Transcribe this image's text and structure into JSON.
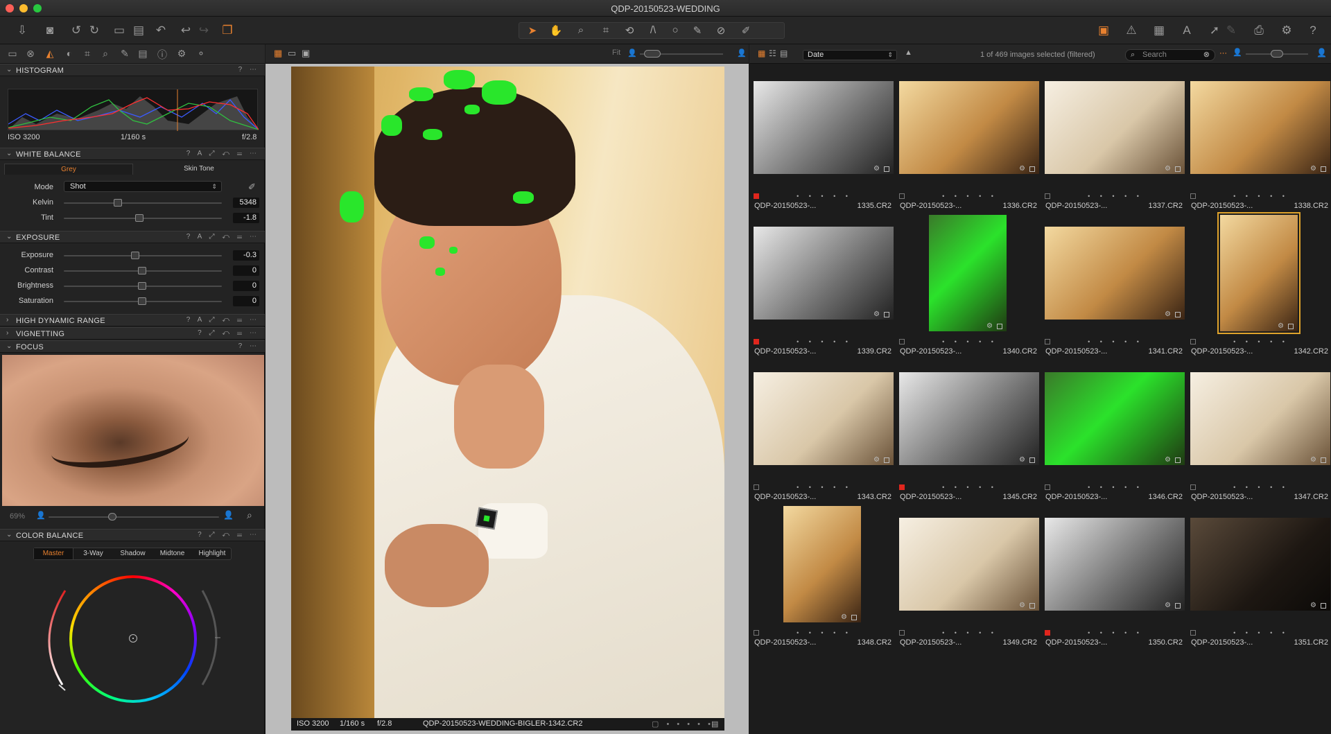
{
  "window": {
    "title": "QDP-20150523-WEDDING"
  },
  "histogram": {
    "title": "HISTOGRAM",
    "iso": "ISO 3200",
    "shutter": "1/160 s",
    "aperture": "f/2.8"
  },
  "white_balance": {
    "title": "WHITE BALANCE",
    "tabs": [
      "Grey",
      "Skin Tone"
    ],
    "mode_label": "Mode",
    "mode_value": "Shot",
    "kelvin_label": "Kelvin",
    "kelvin_value": "5348",
    "tint_label": "Tint",
    "tint_value": "-1.8"
  },
  "exposure": {
    "title": "EXPOSURE",
    "rows": [
      {
        "label": "Exposure",
        "value": "-0.3"
      },
      {
        "label": "Contrast",
        "value": "0"
      },
      {
        "label": "Brightness",
        "value": "0"
      },
      {
        "label": "Saturation",
        "value": "0"
      }
    ]
  },
  "sections": {
    "hdr": "HIGH DYNAMIC RANGE",
    "vignetting": "VIGNETTING",
    "focus": "FOCUS",
    "color_balance": "COLOR BALANCE"
  },
  "focus": {
    "zoom": "69%"
  },
  "color_balance": {
    "tabs": [
      "Master",
      "3-Way",
      "Shadow",
      "Midtone",
      "Highlight"
    ]
  },
  "viewer": {
    "fit_label": "Fit",
    "footer": {
      "iso": "ISO 3200",
      "shutter": "1/160 s",
      "aperture": "f/2.8",
      "filename": "QDP-20150523-WEDDING-BIGLER-1342.CR2"
    }
  },
  "browser": {
    "sort_value": "Date",
    "selection_count": "1 of 469 images selected (filtered)",
    "search_placeholder": "Search",
    "thumbnails": [
      {
        "prefix": "QDP-20150523-...",
        "suffix": "1335.CR2",
        "tag": "red",
        "style": "bw",
        "selected": false
      },
      {
        "prefix": "QDP-20150523-...",
        "suffix": "1336.CR2",
        "tag": "none",
        "style": "warm",
        "selected": false
      },
      {
        "prefix": "QDP-20150523-...",
        "suffix": "1337.CR2",
        "tag": "none",
        "style": "light",
        "selected": false
      },
      {
        "prefix": "QDP-20150523-...",
        "suffix": "1338.CR2",
        "tag": "none",
        "style": "warm",
        "selected": false
      },
      {
        "prefix": "QDP-20150523-...",
        "suffix": "1339.CR2",
        "tag": "red",
        "style": "bw",
        "selected": false
      },
      {
        "prefix": "QDP-20150523-...",
        "suffix": "1340.CR2",
        "tag": "none",
        "style": "green",
        "selected": false
      },
      {
        "prefix": "QDP-20150523-...",
        "suffix": "1341.CR2",
        "tag": "none",
        "style": "warm",
        "selected": false
      },
      {
        "prefix": "QDP-20150523-...",
        "suffix": "1342.CR2",
        "tag": "none",
        "style": "warm",
        "selected": true
      },
      {
        "prefix": "QDP-20150523-...",
        "suffix": "1343.CR2",
        "tag": "none",
        "style": "light",
        "selected": false
      },
      {
        "prefix": "QDP-20150523-...",
        "suffix": "1345.CR2",
        "tag": "red",
        "style": "bw",
        "selected": false
      },
      {
        "prefix": "QDP-20150523-...",
        "suffix": "1346.CR2",
        "tag": "none",
        "style": "green",
        "selected": false
      },
      {
        "prefix": "QDP-20150523-...",
        "suffix": "1347.CR2",
        "tag": "none",
        "style": "light",
        "selected": false
      },
      {
        "prefix": "QDP-20150523-...",
        "suffix": "1348.CR2",
        "tag": "none",
        "style": "warm",
        "selected": false
      },
      {
        "prefix": "QDP-20150523-...",
        "suffix": "1349.CR2",
        "tag": "none",
        "style": "light",
        "selected": false
      },
      {
        "prefix": "QDP-20150523-...",
        "suffix": "1350.CR2",
        "tag": "red",
        "style": "bw",
        "selected": false
      },
      {
        "prefix": "QDP-20150523-...",
        "suffix": "1351.CR2",
        "tag": "none",
        "style": "dark",
        "selected": false
      }
    ]
  },
  "colors": {
    "accent": "#e8812f",
    "selection": "#e0a32b",
    "red_tag": "#e0261d",
    "focus_mask": "#29e62b"
  }
}
